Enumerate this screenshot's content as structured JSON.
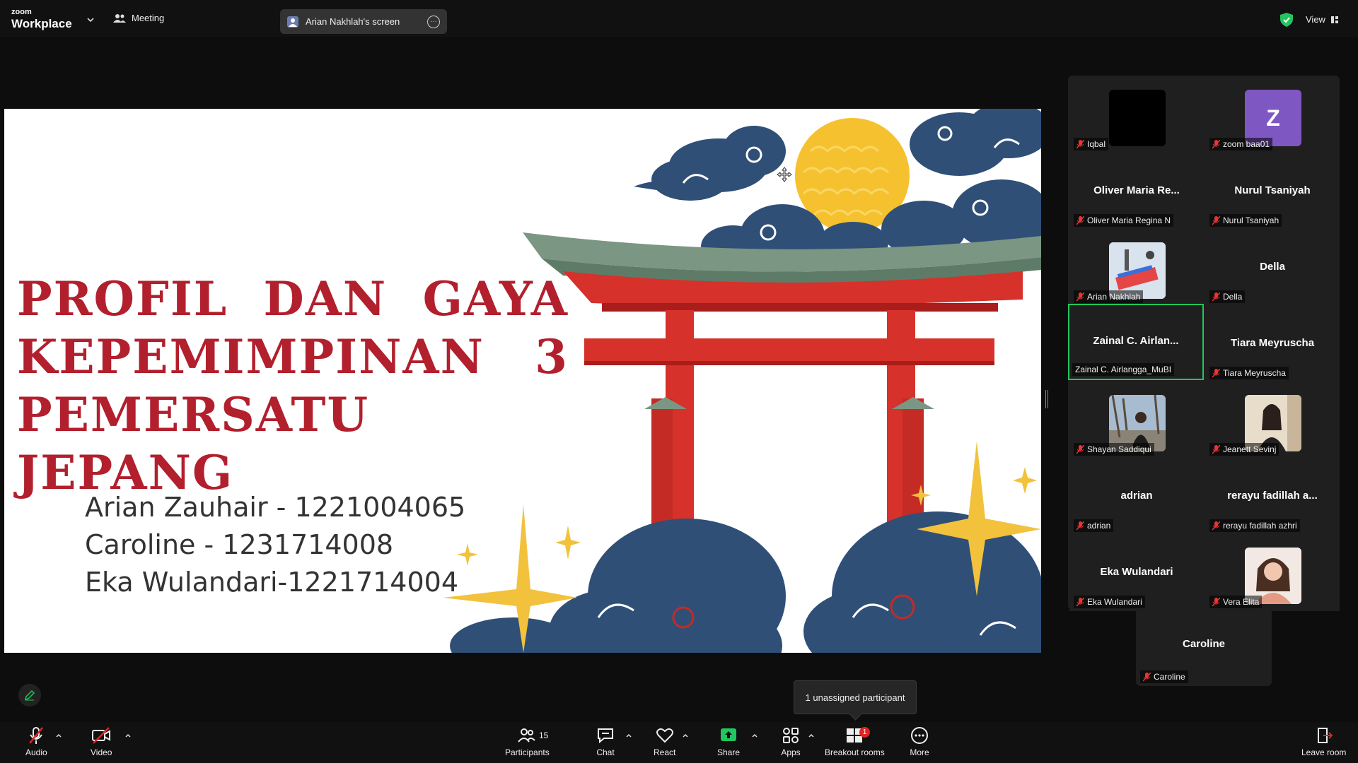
{
  "topbar": {
    "logo_top": "zoom",
    "logo_bottom": "Workplace",
    "meeting_label": "Meeting",
    "share_label": "Arian Nakhlah's screen",
    "share_more": "···",
    "view_label": "View"
  },
  "slide": {
    "title_line1": [
      "PROFIL",
      "DAN",
      "GAYA"
    ],
    "title_line2": [
      "KEPEMIMPINAN",
      "3"
    ],
    "title_line3": "PEMERSATU JEPANG",
    "names": [
      "Arian Zauhair - 1221004065",
      "Caroline - 1231714008",
      "Eka Wulandari-1221714004"
    ],
    "colors": {
      "title": "#b21f2d",
      "sun": "#f5c12e",
      "cloud": "#2f4f77",
      "torii": "#d6312a",
      "roof": "#7b9682"
    }
  },
  "participants": [
    {
      "label": "Iqbal",
      "display": "",
      "type": "black"
    },
    {
      "label": "zoom baa01",
      "display": "Z",
      "type": "letter"
    },
    {
      "label": "Oliver Maria Regina N",
      "display": "Oliver  Maria  Re...",
      "type": "name"
    },
    {
      "label": "Nurul Tsaniyah",
      "display": "Nurul Tsaniyah",
      "type": "name"
    },
    {
      "label": "Arian Nakhlah",
      "display": "",
      "type": "image"
    },
    {
      "label": "Della",
      "display": "Della",
      "type": "name"
    },
    {
      "label": "Zainal C. Airlangga_MuBI",
      "display": "Zainal  C.  Airlan...",
      "type": "name",
      "active": true
    },
    {
      "label": "Tiara Meyruscha",
      "display": "Tiara Meyruscha",
      "type": "name"
    },
    {
      "label": "Shayan Saddiqui",
      "display": "",
      "type": "image"
    },
    {
      "label": "Jeanett Sevinj",
      "display": "",
      "type": "image"
    },
    {
      "label": "adrian",
      "display": "adrian",
      "type": "name"
    },
    {
      "label": "rerayu fadillah azhri",
      "display": "rerayu  fadillah  a...",
      "type": "name"
    },
    {
      "label": "Eka Wulandari",
      "display": "Eka Wulandari",
      "type": "name"
    },
    {
      "label": "Vera Elita",
      "display": "",
      "type": "image"
    },
    {
      "label": "Caroline",
      "display": "Caroline",
      "type": "name"
    }
  ],
  "tooltip": "1 unassigned participant",
  "toolbar": {
    "audio": "Audio",
    "video": "Video",
    "participants": "Participants",
    "participants_count": "15",
    "chat": "Chat",
    "react": "React",
    "share": "Share",
    "apps": "Apps",
    "breakout": "Breakout rooms",
    "breakout_badge": "1",
    "more": "More",
    "leave": "Leave room"
  }
}
